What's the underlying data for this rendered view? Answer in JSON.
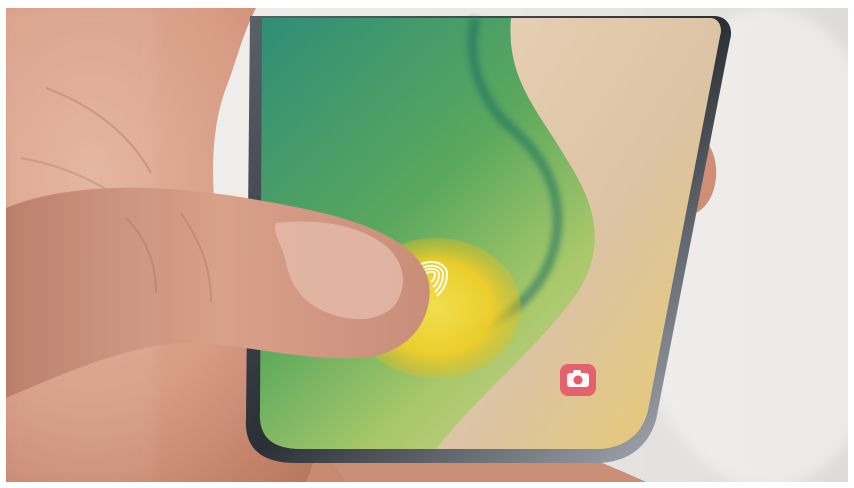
{
  "image": {
    "subject": "",
    "palette": {
      "background": "#e9e7e4",
      "skin": "#d9a08a",
      "skin_shadow": "#a86c56",
      "phone_body": "#2a2f36",
      "screen_green": "#4e9a6a",
      "screen_sand": "#e7c9a5",
      "fingerprint_glow": "#f2d12a",
      "camera_icon_bg": "#e45c6b"
    },
    "icons": [
      "fingerprint-icon",
      "camera-icon"
    ]
  }
}
